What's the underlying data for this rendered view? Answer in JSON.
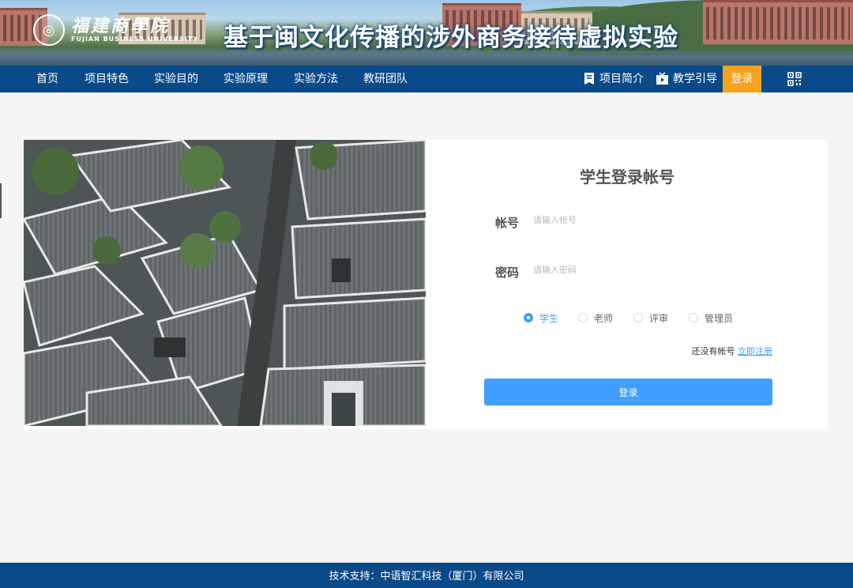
{
  "banner": {
    "logo_cn": "福建商學院",
    "logo_en": "FUJIAN BUSINESS UNIVERSITY",
    "title": "基于闽文化传播的涉外商务接待虚拟实验"
  },
  "nav": {
    "items": [
      "首页",
      "项目特色",
      "实验目的",
      "实验原理",
      "实验方法",
      "教研团队"
    ],
    "project_intro": "项目简介",
    "guide": "教学引导",
    "login": "登录"
  },
  "login": {
    "title": "学生登录帐号",
    "account_label": "帐号",
    "account_placeholder": "请输入帐号",
    "password_label": "密码",
    "password_placeholder": "请输入密码",
    "roles": [
      "学生",
      "老师",
      "评审",
      "管理员"
    ],
    "selected_role": "学生",
    "no_account_text": "还没有帐号",
    "register_link": "立即注册",
    "submit": "登录"
  },
  "footer": {
    "text": "技术支持：中语智汇科技（厦门）有限公司"
  },
  "colors": {
    "nav_bg": "#0b4a89",
    "accent": "#409eff",
    "login_highlight": "#f5a31d"
  }
}
